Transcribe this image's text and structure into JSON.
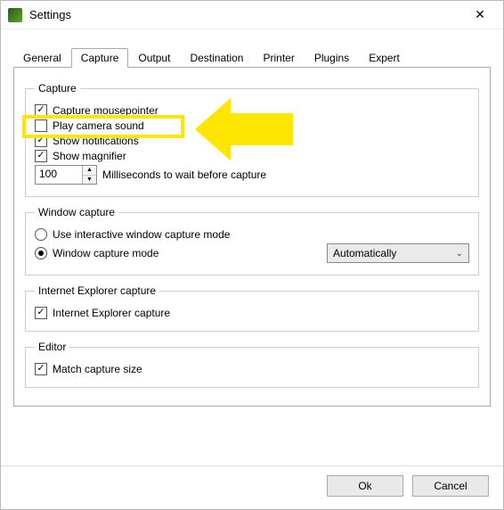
{
  "window": {
    "title": "Settings"
  },
  "tabs": {
    "general": "General",
    "capture": "Capture",
    "output": "Output",
    "destination": "Destination",
    "printer": "Printer",
    "plugins": "Plugins",
    "expert": "Expert"
  },
  "capture_group": {
    "legend": "Capture",
    "mousepointer": "Capture mousepointer",
    "camera_sound": "Play camera sound",
    "notifications": "Show notifications",
    "magnifier": "Show magnifier",
    "ms_value": "100",
    "ms_label": "Milliseconds to wait before capture"
  },
  "window_capture": {
    "legend": "Window capture",
    "interactive": "Use interactive window capture mode",
    "mode": "Window capture mode",
    "combo_value": "Automatically"
  },
  "ie_capture": {
    "legend": "Internet Explorer capture",
    "ie": "Internet Explorer capture"
  },
  "editor": {
    "legend": "Editor",
    "match_size": "Match capture size"
  },
  "buttons": {
    "ok": "Ok",
    "cancel": "Cancel"
  }
}
